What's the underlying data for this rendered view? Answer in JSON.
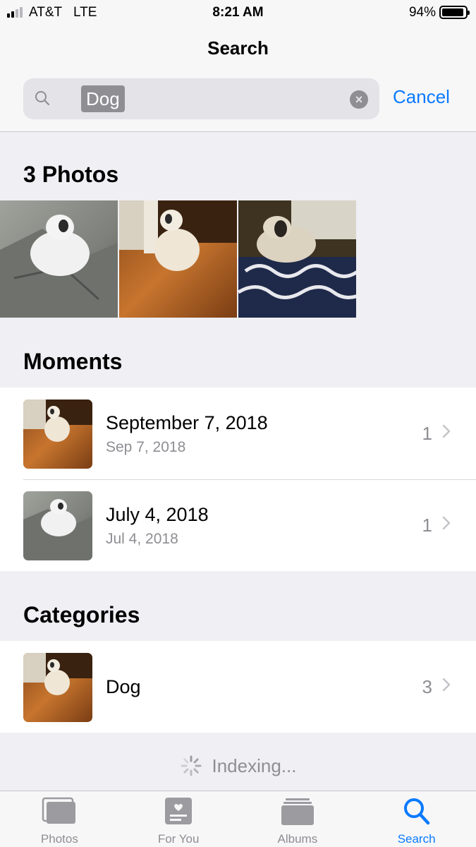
{
  "status_bar": {
    "carrier": "AT&T",
    "network": "LTE",
    "time": "8:21 AM",
    "battery_percent": "94%",
    "battery_level": 0.94,
    "signal_bars_filled": 2
  },
  "header": {
    "title": "Search",
    "search_token": "Dog",
    "cancel_label": "Cancel"
  },
  "photos_section": {
    "title": "3 Photos",
    "photos": [
      {
        "icon": "cat-on-stone-photo"
      },
      {
        "icon": "cat-on-wood-floor-photo"
      },
      {
        "icon": "cat-on-cushion-photo"
      }
    ]
  },
  "moments_section": {
    "title": "Moments",
    "items": [
      {
        "title": "September 7, 2018",
        "subtitle": "Sep 7, 2018",
        "count": "1"
      },
      {
        "title": "July 4, 2018",
        "subtitle": "Jul 4, 2018",
        "count": "1"
      }
    ]
  },
  "categories_section": {
    "title": "Categories",
    "items": [
      {
        "title": "Dog",
        "count": "3"
      }
    ]
  },
  "indexing_label": "Indexing...",
  "tab_bar": {
    "tabs": [
      {
        "label": "Photos",
        "icon": "photos-icon"
      },
      {
        "label": "For You",
        "icon": "for-you-icon"
      },
      {
        "label": "Albums",
        "icon": "albums-icon"
      },
      {
        "label": "Search",
        "icon": "search-icon",
        "active": true
      }
    ]
  },
  "colors": {
    "accent": "#0a7aff",
    "background": "#efeff4",
    "secondary_text": "#8e8e93"
  }
}
